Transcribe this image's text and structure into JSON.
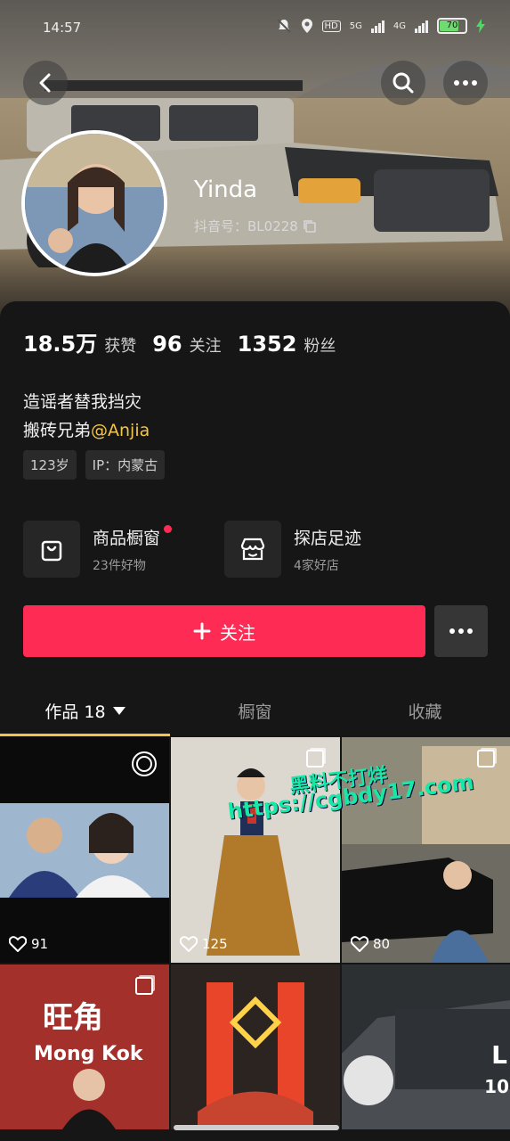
{
  "status_bar": {
    "time": "14:57",
    "hd": "HD",
    "net1": "5G",
    "net2": "4G",
    "battery": "70"
  },
  "profile": {
    "nickname": "Yinda",
    "douyin_id": "抖音号：BL0228",
    "stats": [
      {
        "num": "18.5万",
        "label": "获赞"
      },
      {
        "num": "96",
        "label": "关注"
      },
      {
        "num": "1352",
        "label": "粉丝"
      }
    ],
    "bio_line1": "造谣者替我挡灾",
    "bio_line2_prefix": "搬砖兄弟",
    "bio_mention": "@Anjia",
    "tags": [
      "123岁",
      "IP：内蒙古"
    ]
  },
  "features": {
    "showcase": {
      "title": "商品橱窗",
      "sub": "23件好物"
    },
    "visits": {
      "title": "探店足迹",
      "sub": "4家好店"
    }
  },
  "actions": {
    "follow_label": "关注"
  },
  "tabs": [
    {
      "label": "作品 18",
      "active": true
    },
    {
      "label": "橱窗",
      "active": false
    },
    {
      "label": "收藏",
      "active": false
    }
  ],
  "videos": [
    {
      "likes": "91"
    },
    {
      "likes": "125"
    },
    {
      "likes": "80"
    }
  ],
  "tile_text": {
    "mongkok_cn": "旺角",
    "mongkok_en": "Mong Kok",
    "tile6_letter": "L",
    "tile6_count": "10"
  },
  "watermark": {
    "line1": "黑料不打烊",
    "line2": "https://cgbdy17.com"
  },
  "colors": {
    "accent": "#fe2c55",
    "tab_indicator": "#f4c54a",
    "mention": "#f4c54a",
    "background": "#161616"
  }
}
